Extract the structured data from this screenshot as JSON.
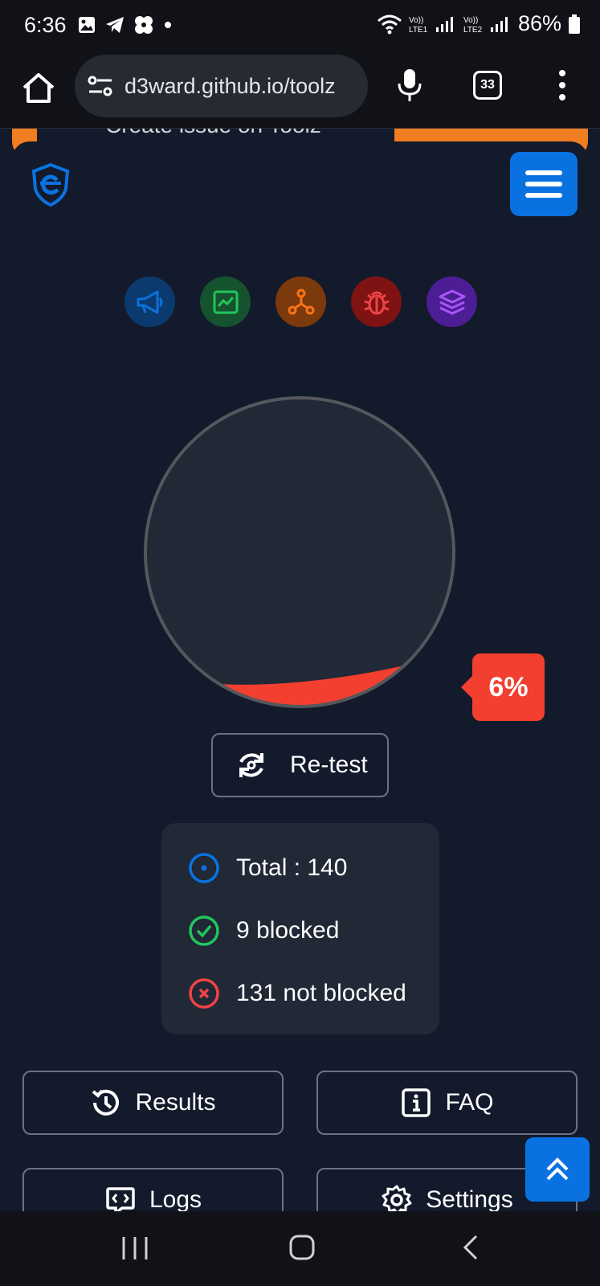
{
  "status_bar": {
    "time": "6:36",
    "battery": "86%",
    "sim1": "Vo)) LTE1",
    "sim2": "Vo)) LTE2",
    "icons": [
      "image-icon",
      "telegram-icon",
      "pinwheel-icon",
      "dot-icon",
      "wifi-icon",
      "signal-icon",
      "battery-icon"
    ]
  },
  "browser": {
    "url": "d3ward.github.io/toolz",
    "tab_count": "33"
  },
  "banner": {
    "text": "Create issue on Toolz",
    "color": "#f07d1f"
  },
  "header": {
    "logo_icon": "shield-logo-icon",
    "menu_icon": "hamburger-icon"
  },
  "features": [
    {
      "icon": "megaphone-icon",
      "color": "#0a72e0",
      "bg": "#0b3a6e"
    },
    {
      "icon": "chart-icon",
      "color": "#22c55e",
      "bg": "#14532d"
    },
    {
      "icon": "network-icon",
      "color": "#f97316",
      "bg": "#7c3a0c"
    },
    {
      "icon": "bug-icon",
      "color": "#ef4444",
      "bg": "#7f1212"
    },
    {
      "icon": "layers-icon",
      "color": "#a855f7",
      "bg": "#4c1d95"
    }
  ],
  "gauge": {
    "percent_label": "6%",
    "fraction": 0.06,
    "fill_color": "#f23f2f"
  },
  "retest": {
    "label": "Re-test"
  },
  "stats": {
    "total": "Total : 140",
    "blocked": "9 blocked",
    "not_blocked": "131 not blocked"
  },
  "actions": {
    "results": "Results",
    "faq": "FAQ",
    "logs": "Logs",
    "settings": "Settings"
  }
}
